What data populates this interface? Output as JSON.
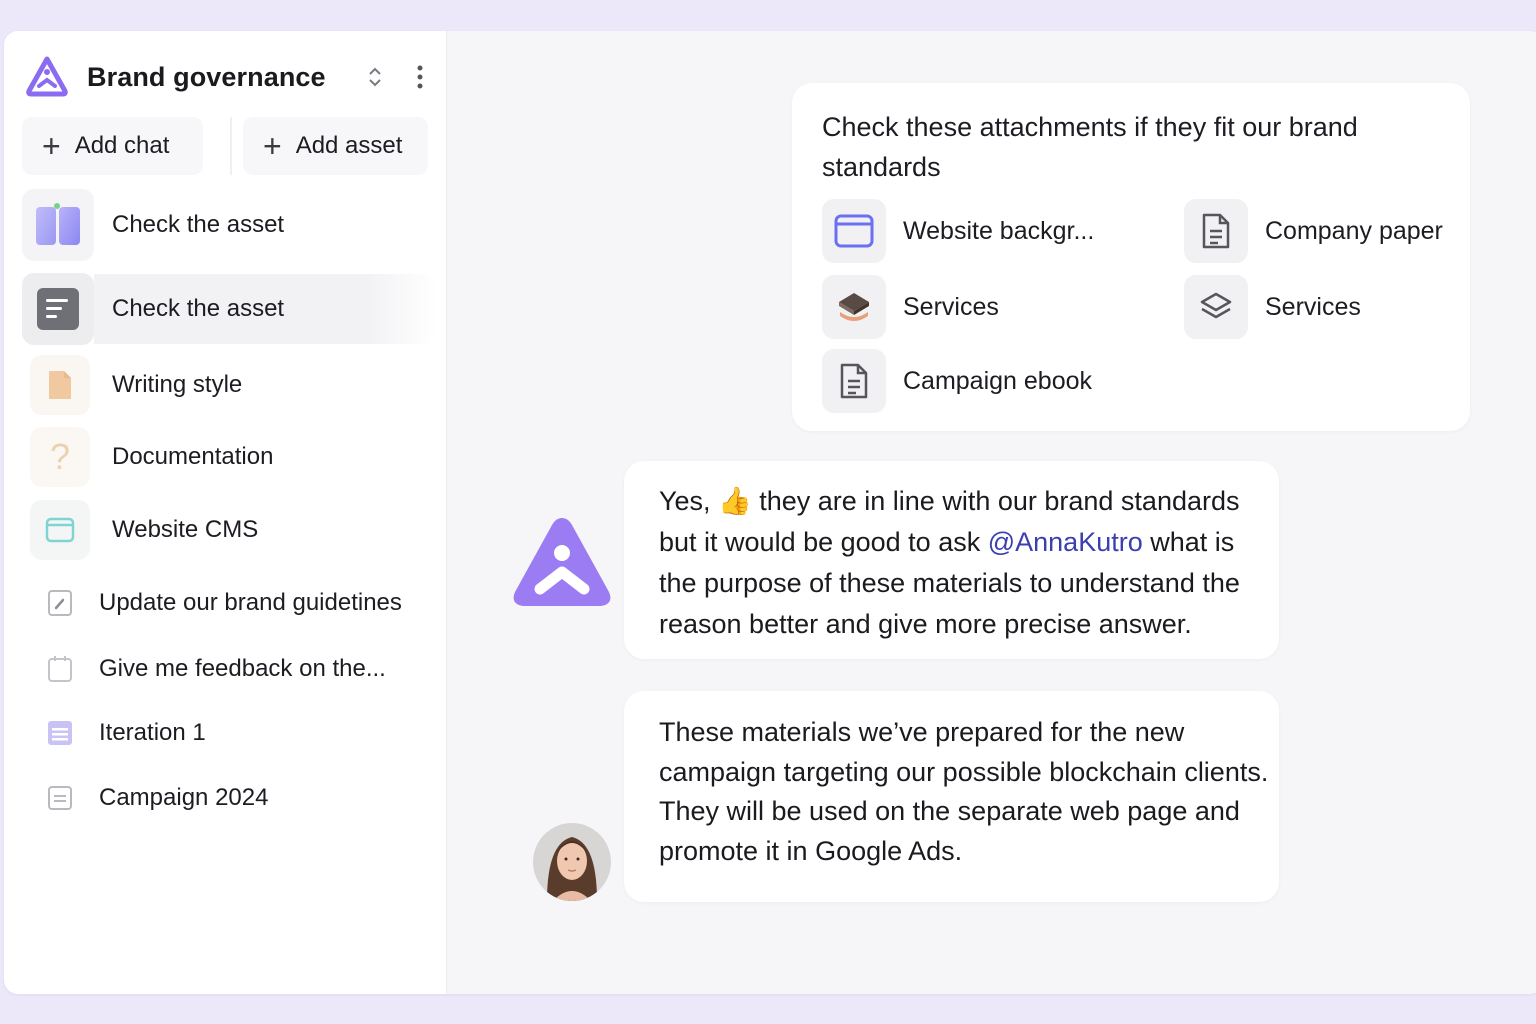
{
  "workspace": {
    "title": "Brand governance",
    "logo": "brand-logo-triangle",
    "accent_color": "#8b6cf0"
  },
  "sidebar": {
    "add_chat_label": "Add chat",
    "add_asset_label": "Add asset",
    "assets": [
      {
        "label": "Check the asset",
        "icon": "phone-gradient-icon"
      },
      {
        "label": "Check the asset",
        "icon": "document-gray-icon",
        "active": true
      },
      {
        "label": "Writing style",
        "icon": "paper-beige-icon"
      },
      {
        "label": "Documentation",
        "icon": "question-icon"
      },
      {
        "label": "Website CMS",
        "icon": "browser-window-icon"
      }
    ],
    "chats": [
      {
        "label": "Update our brand guidetines",
        "icon": "edit-icon"
      },
      {
        "label": "Give me feedback on the...",
        "icon": "calendar-icon"
      },
      {
        "label": "Iteration 1",
        "icon": "list-purple-icon"
      },
      {
        "label": "Campaign 2024",
        "icon": "list-gray-icon"
      }
    ]
  },
  "conversation": {
    "request": {
      "text": "Check these attachments if they fit our brand standards",
      "attachments": [
        {
          "label": "Website backgr...",
          "icon": "browser-window-icon"
        },
        {
          "label": "Company paper",
          "icon": "document-icon"
        },
        {
          "label": "Services",
          "icon": "stack-3d-icon"
        },
        {
          "label": "Services",
          "icon": "layers-icon"
        },
        {
          "label": "Campaign ebook",
          "icon": "document-icon"
        }
      ]
    },
    "ai_reply": {
      "prefix": "Yes,",
      "emoji": "👍",
      "middle": "they are in line with our brand standards but it would be good to ask",
      "mention": "@AnnaKutro",
      "suffix": "what is the purpose of these materials to understand the reason better and give more precise answer."
    },
    "user_message": {
      "text": "These materials we’ve prepared for the new campaign targeting our possible blockchain clients. They will be used on the separate web page and promote it in Google Ads."
    }
  }
}
